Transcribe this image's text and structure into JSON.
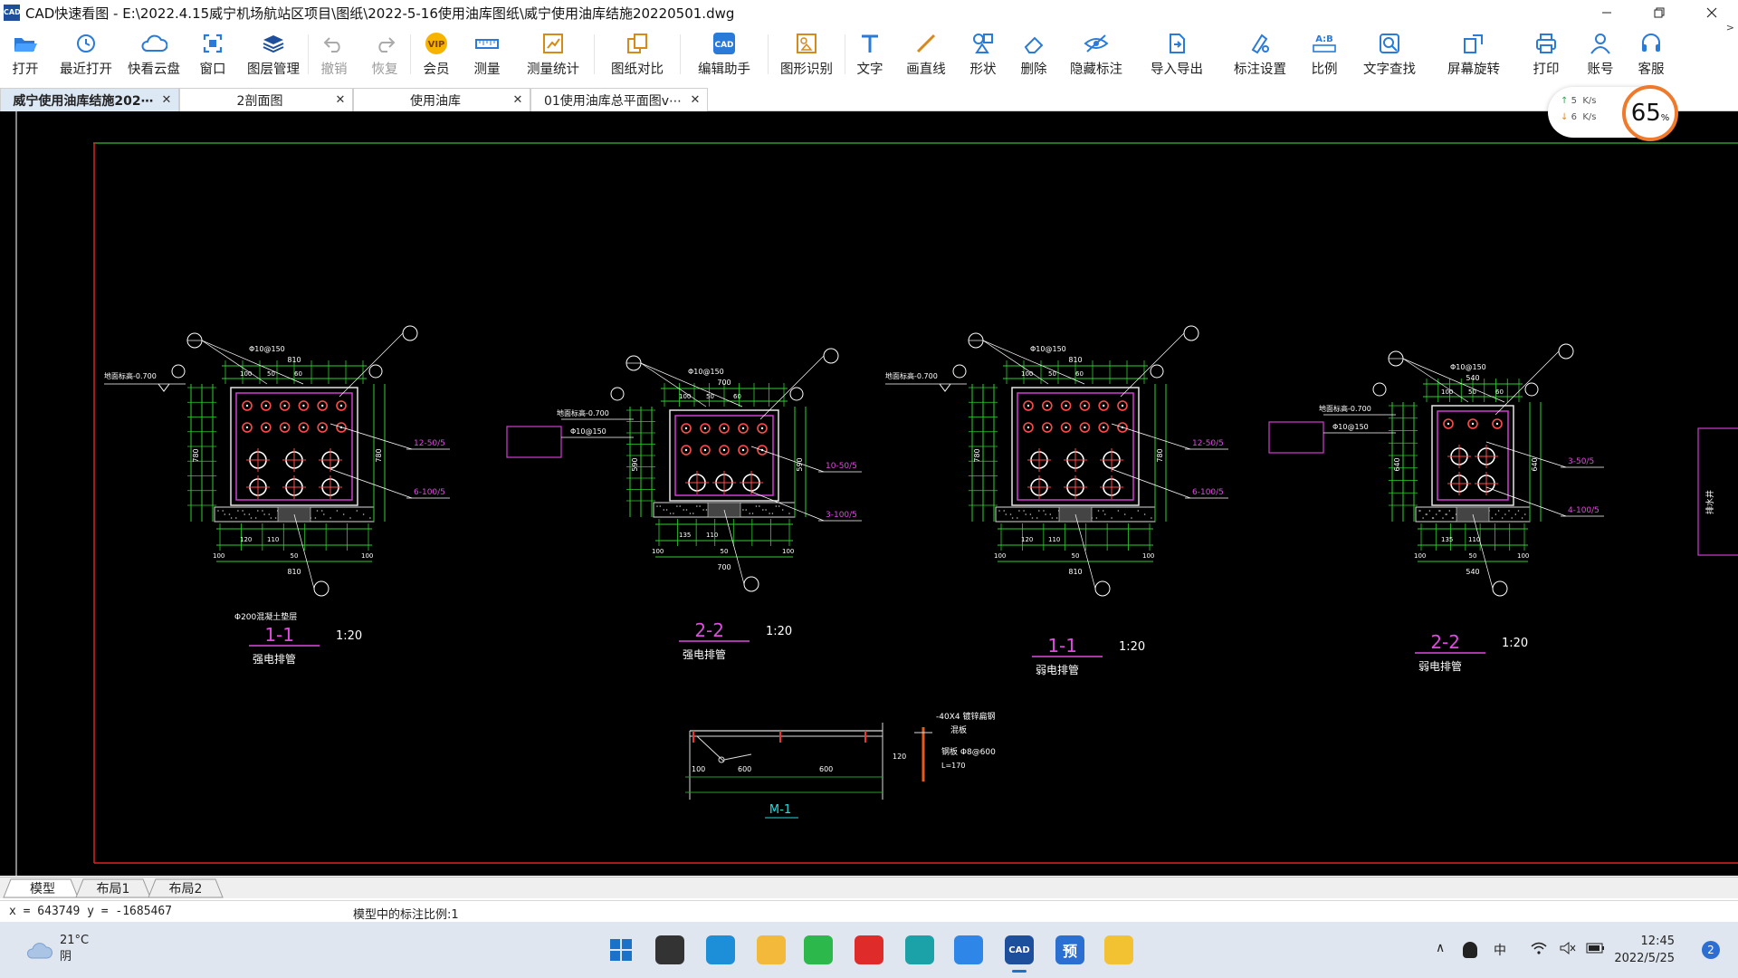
{
  "window": {
    "app_logo": "CAD",
    "title": "CAD快速看图 - E:\\2022.4.15威宁机场航站区项目\\图纸\\2022-5-16使用油库图纸\\威宁使用油库结施20220501.dwg",
    "minimize_icon": "minimize-icon",
    "maximize_icon": "restore-icon",
    "close_icon": "close-icon"
  },
  "toolbar": {
    "items": [
      {
        "label": "打开",
        "icon": "folder-open-icon"
      },
      {
        "label": "最近打开",
        "icon": "history-icon"
      },
      {
        "label": "快看云盘",
        "icon": "cloud-icon"
      },
      {
        "label": "窗口",
        "icon": "window-icon"
      },
      {
        "label": "图层管理",
        "icon": "layers-icon"
      },
      {
        "label": "撤销",
        "icon": "undo-icon",
        "disabled": true
      },
      {
        "label": "恢复",
        "icon": "redo-icon",
        "disabled": true
      },
      {
        "label": "会员",
        "icon": "vip-icon",
        "badge": "VIP"
      },
      {
        "label": "测量",
        "icon": "ruler-icon"
      },
      {
        "label": "测量统计",
        "icon": "measure-stats-icon"
      },
      {
        "label": "图纸对比",
        "icon": "compare-icon"
      },
      {
        "label": "编辑助手",
        "icon": "edit-assistant-icon"
      },
      {
        "label": "图形识别",
        "icon": "shape-recognize-icon"
      },
      {
        "label": "文字",
        "icon": "text-icon"
      },
      {
        "label": "画直线",
        "icon": "line-icon"
      },
      {
        "label": "形状",
        "icon": "shapes-icon"
      },
      {
        "label": "删除",
        "icon": "eraser-icon"
      },
      {
        "label": "隐藏标注",
        "icon": "hide-annotation-icon"
      },
      {
        "label": "导入导出",
        "icon": "import-export-icon"
      },
      {
        "label": "标注设置",
        "icon": "annotation-settings-icon"
      },
      {
        "label": "比例",
        "icon": "scale-icon",
        "badge": "A:B"
      },
      {
        "label": "文字查找",
        "icon": "text-search-icon"
      },
      {
        "label": "屏幕旋转",
        "icon": "rotate-screen-icon"
      },
      {
        "label": "打印",
        "icon": "print-icon"
      },
      {
        "label": "账号",
        "icon": "account-icon"
      },
      {
        "label": "客服",
        "icon": "headset-icon"
      }
    ],
    "more_label": ">"
  },
  "tabs": [
    {
      "label": "威宁使用油库结施202⋯",
      "active": true
    },
    {
      "label": "2剖面图",
      "active": false
    },
    {
      "label": "使用油库",
      "active": false
    },
    {
      "label": "01使用油库总平面图v⋯",
      "active": false
    }
  ],
  "net_speed": {
    "up_value": "5",
    "up_unit": "K/s",
    "down_value": "6",
    "down_unit": "K/s",
    "cpu": "65",
    "cpu_unit": "%"
  },
  "drawing": {
    "sections": [
      {
        "title": "1-1",
        "scale": "1:20",
        "subtitle": "强电排管",
        "pipes_note": "12-50/5",
        "pipes_note2": "6-100/5",
        "ref": "Φ200混凝土垫层"
      },
      {
        "title": "2-2",
        "scale": "1:20",
        "subtitle": "强电排管",
        "pipes_note": "10-50/5",
        "pipes_note2": "3-100/5"
      },
      {
        "title": "1-1",
        "scale": "1:20",
        "subtitle": "弱电排管",
        "pipes_note": "12-50/5",
        "pipes_note2": "6-100/5"
      },
      {
        "title": "2-2",
        "scale": "1:20",
        "subtitle": "弱电排管",
        "pipes_note": "3-50/5",
        "pipes_note2": "4-100/5"
      }
    ],
    "dims": {
      "d810": "810",
      "d780": "780",
      "d700": "700",
      "d590": "590",
      "d540": "540",
      "d640": "640",
      "d120": "120",
      "d110": "110",
      "d100": "100",
      "d135": "135",
      "d50": "50",
      "d60": "60"
    },
    "level_label": "地面标高-0.700",
    "rebar_label": "Φ10@150",
    "detail_title": "M-1",
    "detail_notes": [
      "-40X4 镀锌扁钢",
      "混板",
      "钢板 Φ8@600",
      "L=170"
    ],
    "detail_dims": [
      "100",
      "600",
      "600",
      "120"
    ]
  },
  "layout_tabs": [
    {
      "label": "模型",
      "active": true
    },
    {
      "label": "布局1",
      "active": false
    },
    {
      "label": "布局2",
      "active": false
    }
  ],
  "status": {
    "coords": "x = 643749  y = -1685467",
    "scale_text": "模型中的标注比例:1"
  },
  "taskbar": {
    "temp": "21°C",
    "weather": "阴",
    "apps": [
      {
        "name": "start-icon"
      },
      {
        "name": "task-view-icon"
      },
      {
        "name": "edge-icon"
      },
      {
        "name": "file-explorer-icon"
      },
      {
        "name": "wechat-icon"
      },
      {
        "name": "wps-icon"
      },
      {
        "name": "browser-icon"
      },
      {
        "name": "tencent-docs-icon"
      },
      {
        "name": "cad-viewer-icon",
        "label": "CAD"
      },
      {
        "name": "preview-icon",
        "label": "预"
      },
      {
        "name": "notes-icon"
      }
    ],
    "ime": "中",
    "time": "12:45",
    "date": "2022/5/25",
    "notifications": "2"
  }
}
